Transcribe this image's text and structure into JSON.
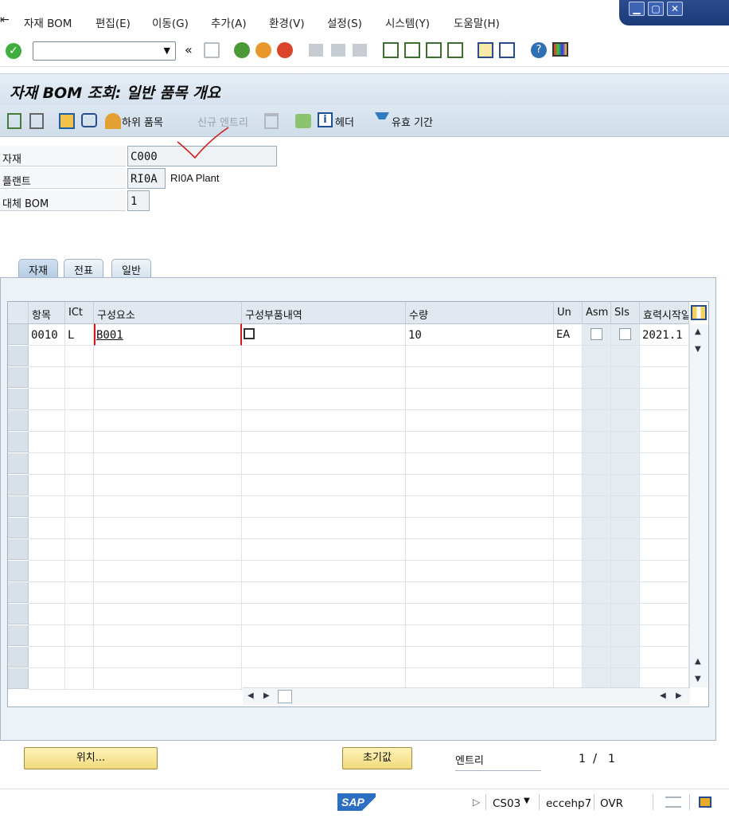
{
  "menubar": {
    "items": [
      "자재 BOM",
      "편집(E)",
      "이동(G)",
      "추가(A)",
      "환경(V)",
      "설정(S)",
      "시스템(Y)",
      "도움말(H)"
    ]
  },
  "title": "자재 BOM 조회: 일반 품목 개요",
  "app_toolbar": {
    "sub_items": "하위 품목",
    "new_entry": "신규 엔트리",
    "header": "헤더",
    "validity": "유효 기간"
  },
  "form": {
    "material_label": "자재",
    "material_value": "C000",
    "plant_label": "플랜트",
    "plant_value": "RI0A",
    "plant_desc": "RI0A Plant",
    "alt_bom_label": "대체 BOM",
    "alt_bom_value": "1"
  },
  "tabs": [
    "자재",
    "전표",
    "일반"
  ],
  "table": {
    "headers": [
      "항목",
      "ICt",
      "구성요소",
      "구성부품내역",
      "수량",
      "Un",
      "Asm",
      "SIs",
      "효력시작일"
    ],
    "rows": [
      {
        "item": "0010",
        "ict": "L",
        "component": "B001",
        "desc": "",
        "qty": "10",
        "unit": "EA",
        "valid_from": "2021.1"
      }
    ]
  },
  "bottom": {
    "position_btn": "위치...",
    "reset_btn": "초기값",
    "entry_label": "엔트리",
    "page_current": "1",
    "page_sep": "/",
    "page_total": "1"
  },
  "status": {
    "logo": "SAP",
    "tcode": "CS03",
    "server": "eccehp7",
    "mode": "OVR"
  },
  "colors": {
    "accent": "#2a4b8d",
    "title_bg": "#dce7f1",
    "annotation": "#d11a1a"
  }
}
